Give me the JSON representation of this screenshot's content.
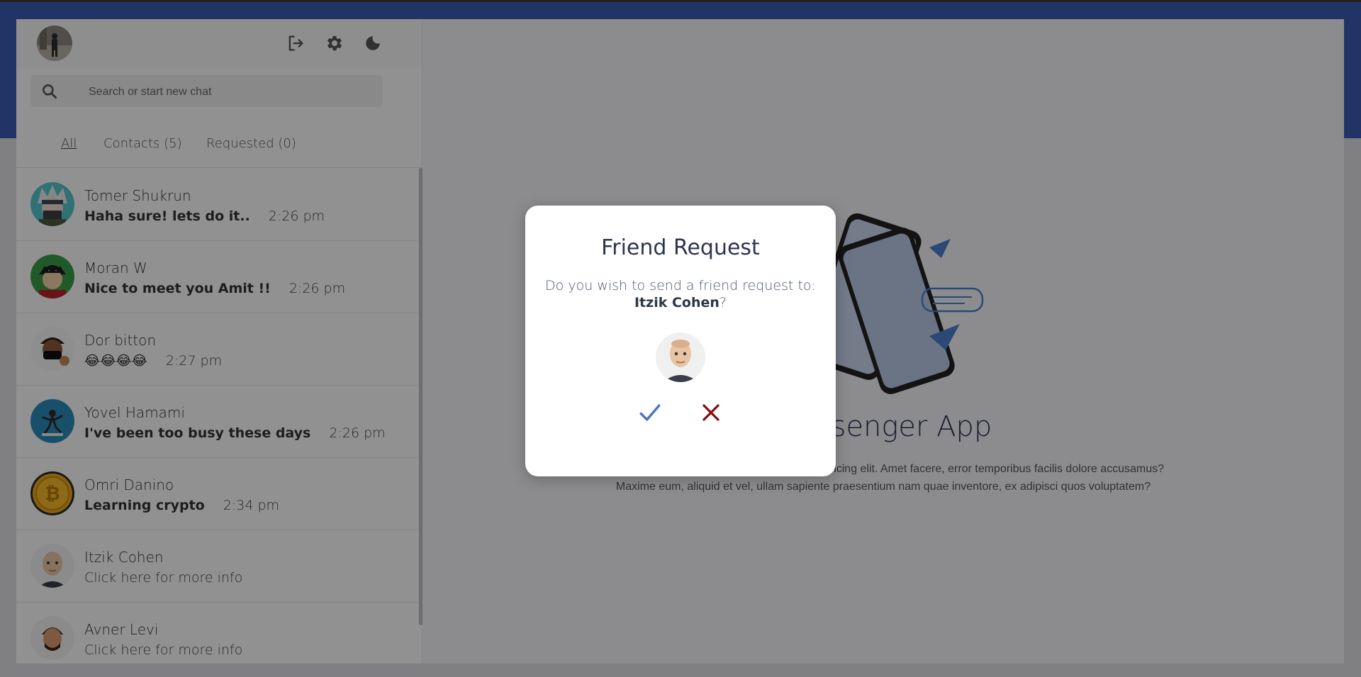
{
  "header": {
    "avatar": "user-photo-avatar",
    "icons": [
      "logout-icon",
      "settings-icon",
      "dark-mode-icon"
    ]
  },
  "search": {
    "placeholder": "Search or start new chat"
  },
  "tabs": [
    {
      "label": "All",
      "active": true
    },
    {
      "label": "Contacts (5)",
      "active": false
    },
    {
      "label": "Requested (0)",
      "active": false
    }
  ],
  "chats": [
    {
      "name": "Tomer Shukrun",
      "message": "Haha sure! lets do it..",
      "time": "2:26 pm",
      "bold": true
    },
    {
      "name": "Moran W",
      "message": "Nice to meet you Amit !!",
      "time": "2:26 pm",
      "bold": true
    },
    {
      "name": "Dor bitton",
      "message": "😂😂😂😂",
      "time": "2:27 pm",
      "bold": true
    },
    {
      "name": "Yovel Hamami",
      "message": "I've been too busy these days",
      "time": "2:26 pm",
      "bold": true
    },
    {
      "name": "Omri Danino",
      "message": "Learning crypto",
      "time": "2:34 pm",
      "bold": true
    },
    {
      "name": "Itzik Cohen",
      "message": "Click here for more info",
      "time": "",
      "bold": false
    },
    {
      "name": "Avner Levi",
      "message": "Click here for more info",
      "time": "",
      "bold": false
    }
  ],
  "main": {
    "title": "Messenger App",
    "description_line1": "Lorem ipsum dolor sit amet consectetur adipisicing elit. Amet facere, error temporibus facilis dolore accusamus?",
    "description_line2": "Maxime eum, aliquid et vel, ullam sapiente praesentium nam quae inventore, ex adipisci quos voluptatem?"
  },
  "modal": {
    "title": "Friend Request",
    "question": "Do you wish to send a friend request to:",
    "target_name": "Itzik Cohen",
    "suffix": "?",
    "confirm_icon": "check-icon",
    "cancel_icon": "close-icon"
  },
  "colors": {
    "top_band": "#3b5bb0",
    "confirm": "#4a72c4",
    "cancel": "#8b0a0a"
  }
}
